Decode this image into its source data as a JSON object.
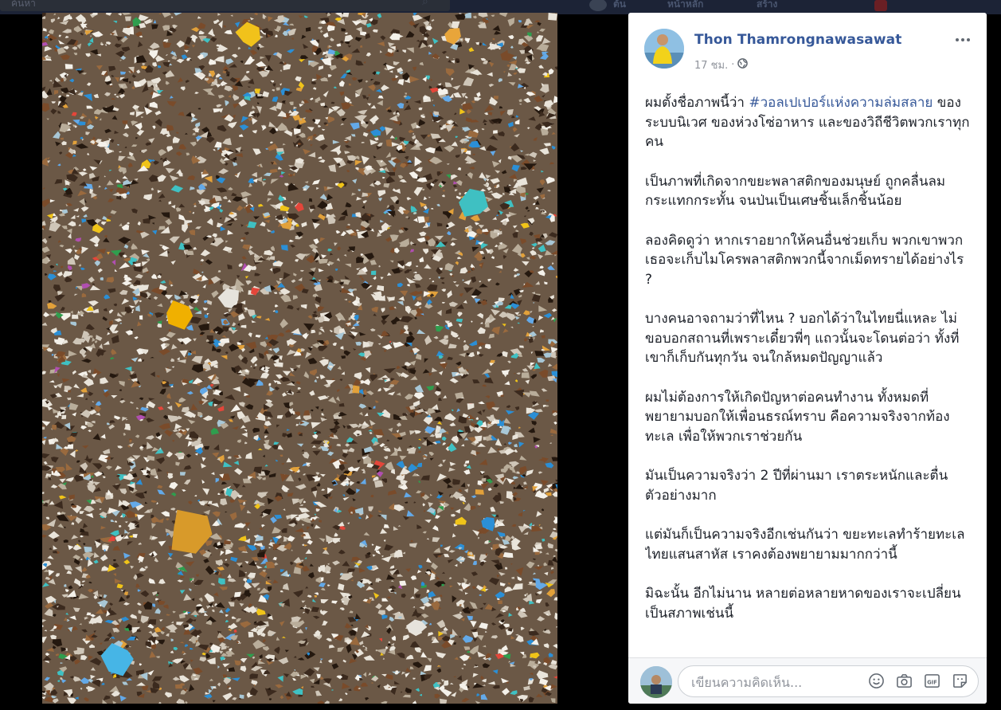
{
  "topbar": {
    "search_text": "ค้นหา",
    "items": [
      "ต้น",
      "หน้าหลัก",
      "สร้าง"
    ]
  },
  "post": {
    "author": "Thon Thamrongnawasawat",
    "time": "17 ชม.",
    "privacy_icon": "globe-icon",
    "paragraphs": [
      {
        "hashtag_prefix": "ผมตั้งชื่อภาพนี้ว่า ",
        "hashtag": "#วอลเปเปอร์แห่งความล่มสลาย",
        "rest": " ของระบบนิเวศ ของห่วงโซ่อาหาร และของวิถีชีวิตพวกเราทุกคน"
      },
      {
        "text": "เป็นภาพที่เกิดจากขยะพลาสติกของมนุษย์ ถูกคลื่นลมกระแทกกระทั้น จนป่นเป็นเศษชิ้นเล็กชิ้นน้อย"
      },
      {
        "text": "ลองคิดดูว่า หากเราอยากให้คนอื่นช่วยเก็บ พวกเขาพวกเธอจะเก็บไมโครพลาสติกพวกนี้จากเม็ดทรายได้อย่างไร ?"
      },
      {
        "text": "บางคนอาจถามว่าที่ไหน ? บอกได้ว่าในไทยนี่แหละ ไม่ขอบอกสถานที่เพราะเดี๋ยวพี่ๆ แถวนั้นจะโดนต่อว่า ทั้งที่เขาก็เก็บกันทุกวัน จนใกล้หมดปัญญาแล้ว"
      },
      {
        "text": "ผมไม่ต้องการให้เกิดปัญหาต่อคนทำงาน ทั้งหมดที่พยายามบอกให้เพื่อนธรณ์ทราบ คือความจริงจากท้องทะเล เพื่อให้พวกเราช่วยกัน"
      },
      {
        "text": "มันเป็นความจริงว่า 2 ปีที่ผ่านมา เราตระหนักและตื่นตัวอย่างมาก"
      },
      {
        "text": "แต่มันก็เป็นความจริงอีกเช่นกันว่า ขยะทะเลทำร้ายทะเลไทยแสนสาหัส เราคงต้องพยายามมากกว่านี้"
      },
      {
        "text": "มิฉะนั้น อีกไม่นาน หลายต่อหลายหาดของเราจะเปลี่ยนเป็นสภาพเช่นนี้"
      }
    ]
  },
  "comment": {
    "placeholder": "เขียนความคิดเห็น...",
    "icons": [
      "emoji-icon",
      "camera-icon",
      "gif-icon",
      "sticker-icon"
    ]
  },
  "colors": {
    "link": "#365899",
    "text": "#1d2129",
    "meta": "#90949c"
  }
}
